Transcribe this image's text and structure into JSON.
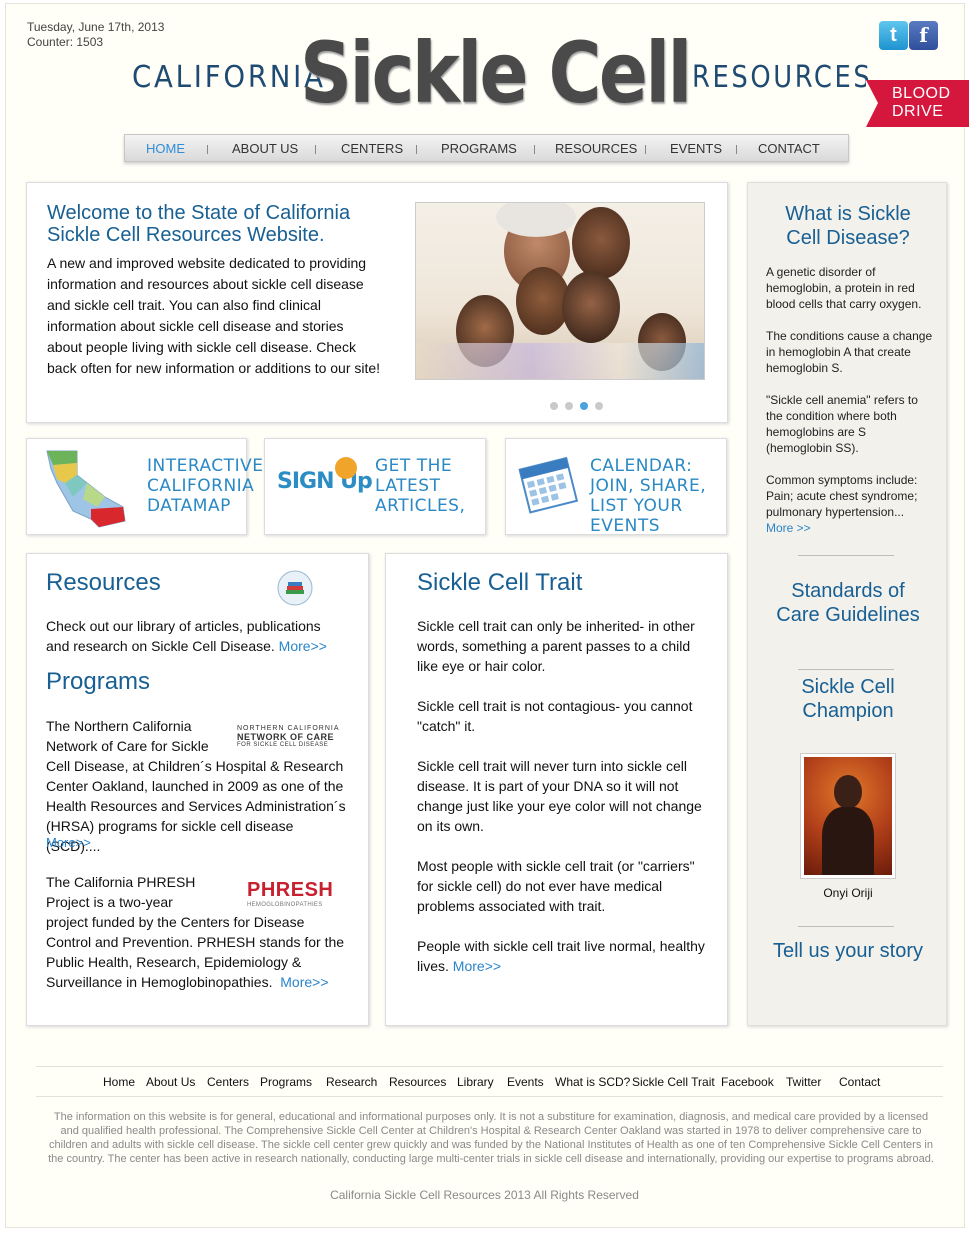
{
  "header": {
    "date": "Tuesday, June 17th, 2013",
    "counter": "Counter: 1503",
    "logo_left": "CALIFORNIA",
    "logo_main": "Sickle Cell",
    "logo_right": "RESOURCES",
    "twitter_label": "t",
    "facebook_label": "f",
    "blood_line1": "BLOOD",
    "blood_line2": "DRIVE"
  },
  "nav": {
    "items": [
      "HOME",
      "ABOUT US",
      "CENTERS",
      "PROGRAMS",
      "RESOURCES",
      "EVENTS",
      "CONTACT"
    ]
  },
  "welcome": {
    "title": "Welcome to the State of California Sickle Cell Resources Website.",
    "body": "A new and improved website dedicated to providing information and resources about sickle cell disease and sickle cell trait. You can also find clinical information about sickle cell disease and stories about people living with sickle cell disease. Check back often for new information or additions to our site!"
  },
  "features": {
    "datamap": "INTERACTIVE CALIFORNIA DATAMAP",
    "signup_logo": "SIGN Up",
    "signup": "GET THE LATEST ARTICLES,",
    "calendar": "CALENDAR: JOIN, SHARE, LIST YOUR EVENTS"
  },
  "resources": {
    "title": "Resources",
    "body": "Check out our library of articles, publications and research on Sickle Cell Disease.",
    "more": "More>>"
  },
  "programs": {
    "title": "Programs",
    "nc_logo_line1": "NORTHERN CALIFORNIA",
    "nc_logo_line2": "NETWORK OF CARE",
    "nc_logo_line3": "FOR SICKLE CELL DISEASE",
    "nc_body_a": "The Northern California Network of Care for Sickle",
    "nc_body_b": "Cell Disease, at Children´s Hospital & Research Center Oakland, launched in 2009 as one of the Health Resources and Services Administration´s (HRSA) programs for sickle cell disease (SCD)....",
    "nc_more": "More>>",
    "phresh_logo": "PHRESH",
    "phresh_logo_sub": "HEMOGLOBINOPATHIES",
    "phresh_body_a": "The California PHRESH Project is a two-year",
    "phresh_body_b": "project funded by the Centers for Disease Control and Prevention. PRHESH stands for the Public Health, Research, Epidemiology & Surveillance in Hemoglobinopathies.",
    "phresh_more": "More>>"
  },
  "trait": {
    "title": "Sickle Cell Trait",
    "p1": "Sickle cell trait can only be inherited- in other words, something a parent passes to a child like eye or hair color.",
    "p2": "Sickle cell trait is not contagious- you cannot \"catch\" it.",
    "p3": "Sickle cell trait will never turn into sickle cell disease. It is part of your DNA so it will not change just like your eye color will not change on its own.",
    "p4": "Most people with sickle cell trait (or \"carriers\" for sickle cell) do not ever have medical problems associated with trait.",
    "p5": "People with sickle cell trait live normal, healthy lives.",
    "more": "More>>"
  },
  "sidebar": {
    "what_title": "What is Sickle Cell Disease?",
    "t1": "A genetic disorder of hemoglobin, a protein in red blood cells that carry oxygen.",
    "t2": "The conditions cause a change in hemoglobin A that create hemoglobin S.",
    "t3": "\"Sickle cell anemia\" refers to the condition where both hemoglobins are S (hemoglobin SS).",
    "t4": "Common symptoms include: Pain; acute chest syndrome; pulmonary hypertension...",
    "more": "More >>",
    "standards": "Standards of Care Guidelines",
    "champion": "Sickle Cell Champion",
    "champion_name": "Onyi Oriji",
    "story": "Tell us your story"
  },
  "footer": {
    "links": [
      "Home",
      "About Us",
      "Centers",
      "Programs",
      "Research",
      "Resources",
      "Library",
      "Events",
      "What is SCD?",
      "Sickle Cell Trait",
      "Facebook",
      "Twitter",
      "Contact"
    ],
    "disclaimer": "The information on this website is for general, educational and informational purposes only. It is not a substiture for examination, diagnosis, and medical care provided by a licensed and qualified health professional. The Comprehensive Sickle Cell Center at Children's Hospital & Research Center Oakland was started in 1978 to deliver comprehensive care to children and adults with sickle cell disease. The sickle cell center grew quickly and was funded by the National Institutes of Health as one of ten Comprehensive Sickle Cell Centers in the country. The center has been active in research nationally, conducting large multi-center trials in sickle cell disease and internationally, providing our expertise to programs abroad.",
    "copyright": "California Sickle Cell Resources 2013 All Rights Reserved"
  },
  "colors": {
    "accent_blue": "#185f93",
    "link_blue": "#2a84c9",
    "blood_red": "#d5173d"
  }
}
